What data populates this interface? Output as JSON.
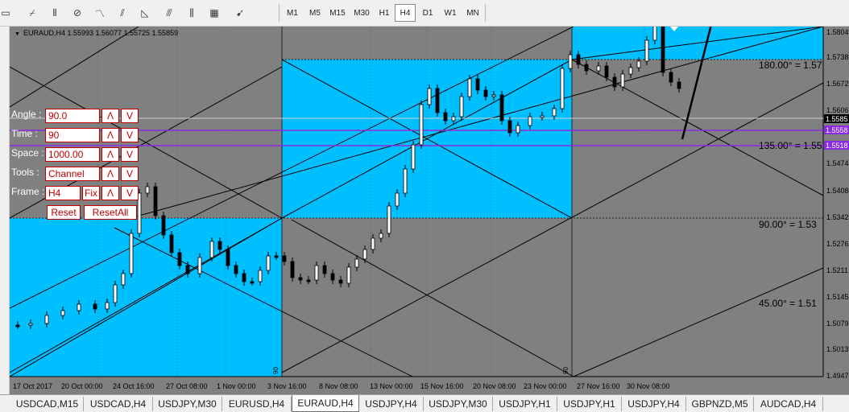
{
  "toolbar": {
    "drawing_tools": [
      {
        "name": "fibonacci-fan-icon",
        "glyph": "⌿"
      },
      {
        "name": "andrews-pitchfork-icon",
        "glyph": "⫴"
      },
      {
        "name": "gann-line-icon",
        "glyph": "⊘"
      },
      {
        "name": "elliott-wave-icon",
        "glyph": "〽"
      },
      {
        "name": "fibonacci-channel-icon",
        "glyph": "⫽"
      },
      {
        "name": "fibonacci-arcs-icon",
        "glyph": "◺"
      },
      {
        "name": "fibonacci-extension-icon",
        "glyph": "⫻"
      },
      {
        "name": "fibonacci-timezones-icon",
        "glyph": "⫼"
      },
      {
        "name": "gann-grid-icon",
        "glyph": "▦"
      },
      {
        "name": "arrows-icon",
        "glyph": "➹"
      }
    ],
    "timeframes": [
      "M1",
      "M5",
      "M15",
      "M30",
      "H1",
      "H4",
      "D1",
      "W1",
      "MN"
    ],
    "active_timeframe": "H4"
  },
  "chart": {
    "symbol_line": "EURAUD,H4  1.55993 1.56077 1.55725 1.55859",
    "price_axis": [
      "1.5804",
      "1.5738",
      "1.5672",
      "1.5606",
      "1.5474",
      "1.5408",
      "1.5342",
      "1.5276",
      "1.5211",
      "1.5145",
      "1.5079",
      "1.5013",
      "1.4947"
    ],
    "current_price_label": "1.5585",
    "purple_level_labels": [
      "1.5558",
      "1.5518"
    ],
    "time_axis": [
      "17 Oct 2017",
      "20 Oct 00:00",
      "24 Oct 16:00",
      "27 Oct 08:00",
      "1 Nov 00:00",
      "3 Nov 16:00",
      "8 Nov 08:00",
      "13 Nov 00:00",
      "15 Nov 16:00",
      "20 Nov 08:00",
      "23 Nov 00:00",
      "27 Nov 16:00",
      "30 Nov 08:00"
    ],
    "angle_labels": [
      "180.00° = 1.57",
      "135.00° = 1.55",
      "90.00° = 1.53",
      "45.00° = 1.51"
    ],
    "vline_marks": [
      "90",
      "90"
    ],
    "colors": {
      "background": "#808080",
      "highlight": "#00bfff",
      "candle": "#000000",
      "purple": "#8a2be2"
    }
  },
  "panel": {
    "angle_label": "Angle :",
    "angle_value": "90.0",
    "time_label": "Time :",
    "time_value": "90",
    "space_label": "Space :",
    "space_value": "1000.00",
    "tools_label": "Tools :",
    "tools_value": "Channel",
    "frame_label": "Frame :",
    "frame_value": "H4",
    "fix_label": "Fix",
    "up_label": "Λ",
    "down_label": "V",
    "reset_label": "Reset",
    "reset_all_label": "ResetAll"
  },
  "tabs": [
    {
      "label": "USDCAD,M15",
      "active": false
    },
    {
      "label": "USDCAD,H4",
      "active": false
    },
    {
      "label": "USDJPY,M30",
      "active": false
    },
    {
      "label": "EURUSD,H4",
      "active": false
    },
    {
      "label": "EURAUD,H4",
      "active": true
    },
    {
      "label": "USDJPY,H4",
      "active": false
    },
    {
      "label": "USDJPY,M30",
      "active": false
    },
    {
      "label": "USDJPY,H1",
      "active": false
    },
    {
      "label": "USDJPY,H1",
      "active": false
    },
    {
      "label": "USDJPY,H4",
      "active": false
    },
    {
      "label": "GBPNZD,M5",
      "active": false
    },
    {
      "label": "AUDCAD,H4",
      "active": false
    }
  ]
}
